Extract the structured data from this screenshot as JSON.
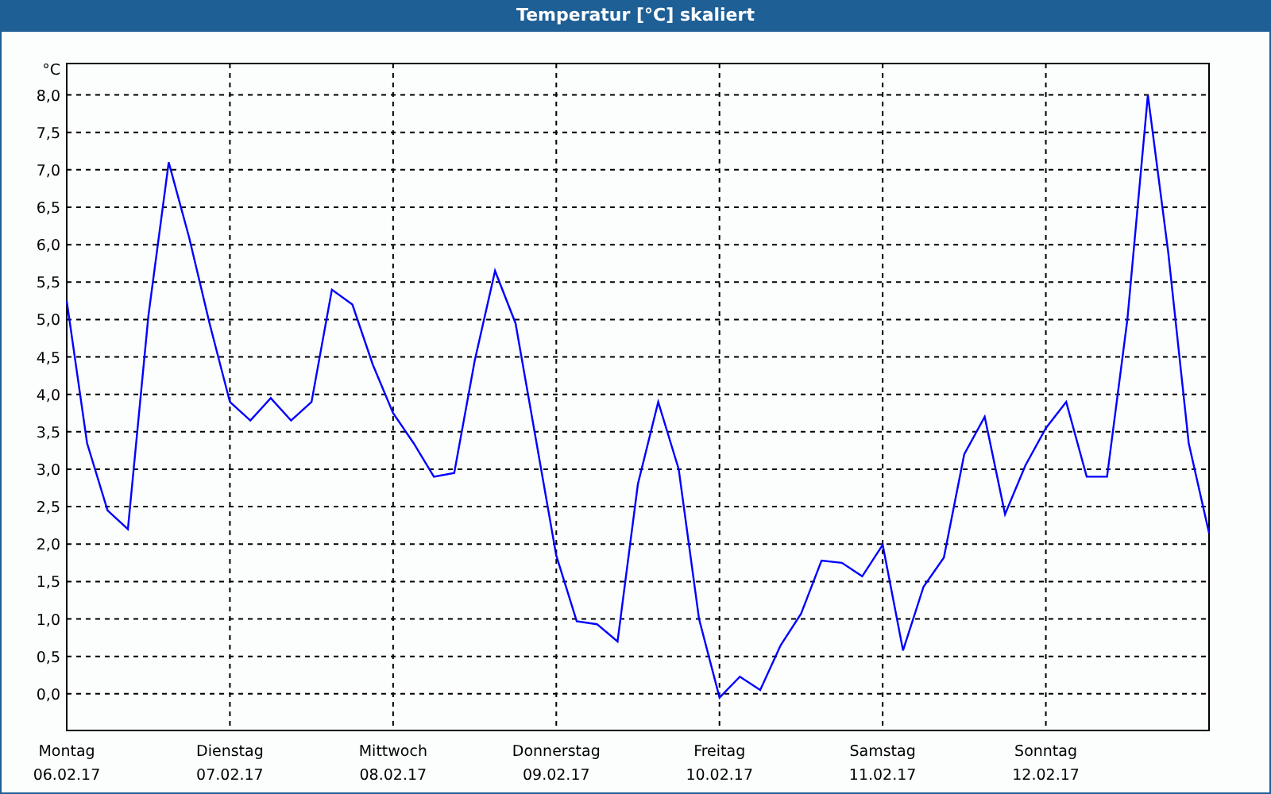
{
  "window": {
    "title": "Temperatur [°C] skaliert"
  },
  "chart": {
    "chart_data": {
      "type": "line",
      "ylabel": "°C",
      "categories": [
        "Montag",
        null,
        null,
        null,
        null,
        null,
        null,
        null,
        "Dienstag",
        null,
        null,
        null,
        null,
        null,
        null,
        null,
        "Mittwoch",
        null,
        null,
        null,
        null,
        null,
        null,
        null,
        "Donnerstag",
        null,
        null,
        null,
        null,
        null,
        null,
        null,
        "Freitag",
        null,
        null,
        null,
        null,
        null,
        null,
        null,
        "Samstag",
        null,
        null,
        null,
        null,
        null,
        null,
        null,
        "Sonntag",
        null,
        null,
        null,
        null,
        null,
        null,
        null,
        null
      ],
      "series": [
        {
          "color": "#0000ff",
          "values": [
            5.25,
            3.35,
            2.45,
            2.2,
            5.05,
            7.1,
            6.1,
            4.95,
            3.9,
            3.65,
            3.95,
            3.65,
            3.9,
            5.4,
            5.2,
            4.4,
            3.75,
            3.35,
            2.9,
            2.95,
            4.45,
            5.65,
            4.95,
            3.4,
            1.85,
            0.97,
            0.93,
            0.7,
            2.8,
            3.9,
            3.0,
            1.0,
            -0.05,
            0.23,
            0.05,
            0.65,
            1.07,
            1.78,
            1.75,
            1.57,
            1.99,
            0.58,
            1.43,
            1.82,
            3.2,
            3.7,
            2.4,
            3.05,
            3.55,
            3.9,
            2.9,
            2.9,
            5.0,
            8.0,
            5.9,
            3.35,
            2.15
          ]
        }
      ],
      "ylim": [
        -0.49,
        8.42
      ],
      "grid": true,
      "yticks": [
        {
          "value": 0,
          "label": "0,0"
        },
        {
          "value": 0.5,
          "label": "0,5"
        },
        {
          "value": 1,
          "label": "1,0"
        },
        {
          "value": 1.5,
          "label": "1,5"
        },
        {
          "value": 2,
          "label": "2,0"
        },
        {
          "value": 2.5,
          "label": "2,5"
        },
        {
          "value": 3,
          "label": "3,0"
        },
        {
          "value": 3.5,
          "label": "3,5"
        },
        {
          "value": 4,
          "label": "4,0"
        },
        {
          "value": 4.5,
          "label": "4,5"
        },
        {
          "value": 5,
          "label": "5,0"
        },
        {
          "value": 5.5,
          "label": "5,5"
        },
        {
          "value": 6,
          "label": "6,0"
        },
        {
          "value": 6.5,
          "label": "6,5"
        },
        {
          "value": 7,
          "label": "7,0"
        },
        {
          "value": 7.5,
          "label": "7,5"
        },
        {
          "value": 8,
          "label": "8,0"
        }
      ]
    },
    "tick_dates": [
      "06.02.17",
      "07.02.17",
      "08.02.17",
      "09.02.17",
      "10.02.17",
      "11.02.17",
      "12.02.17"
    ]
  }
}
